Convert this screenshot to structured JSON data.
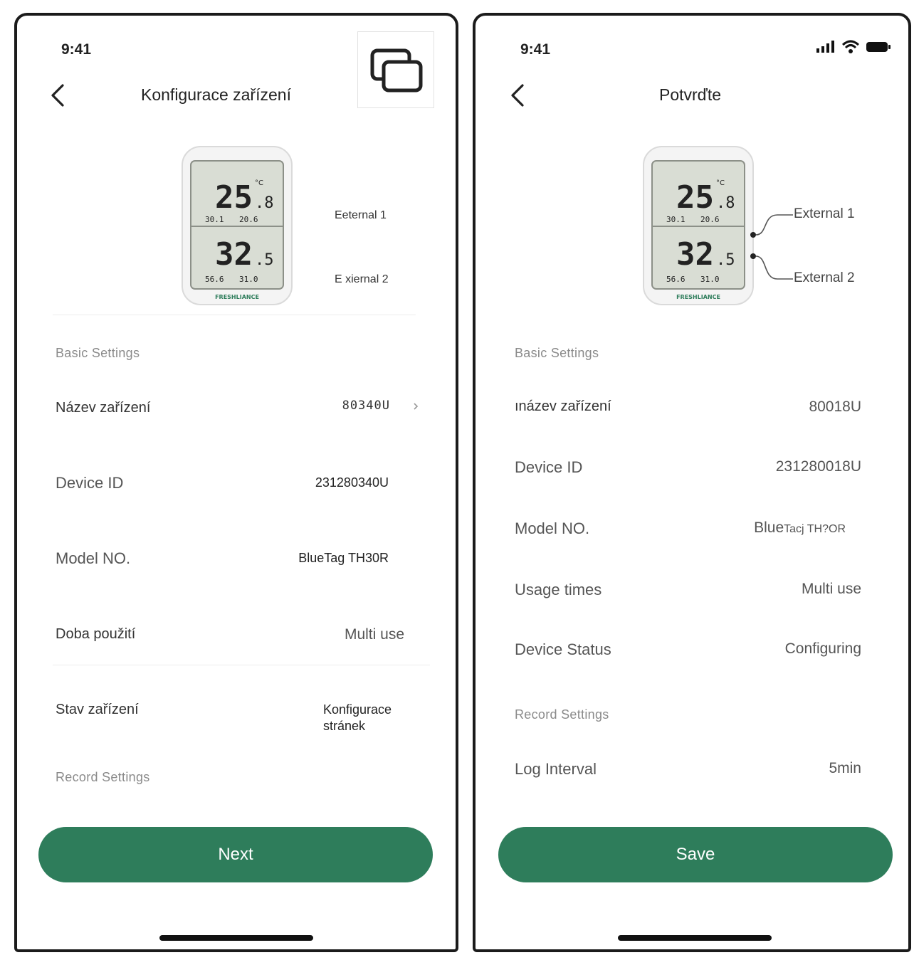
{
  "screen_left": {
    "time": "9:41",
    "title": "Konfigurace zařízení",
    "external_1": "Eeternal 1",
    "external_2": "E xiernal 2",
    "basic_settings": "Basic Settings",
    "rows": [
      {
        "label": "Název zařízení",
        "value": "80340U"
      },
      {
        "label": "Device ID",
        "value": "231280340U"
      },
      {
        "label": "Model NO.",
        "value": "BlueTag TH30R"
      },
      {
        "label": "Doba použití",
        "value": "Multi use"
      },
      {
        "label": "Stav zařízení",
        "value_line1": "Konfigurace",
        "value_line2": "stránek"
      }
    ],
    "record_settings": "Record Settings",
    "button": "Next"
  },
  "screen_right": {
    "time": "9:41",
    "title": "Potvrďte",
    "external_1": "External 1",
    "external_2": "External 2",
    "basic_settings": "Basic Settings",
    "rows": [
      {
        "label": "ınázev zařízení",
        "value": "80018U"
      },
      {
        "label": "Device ID",
        "value": "231280018U"
      },
      {
        "label": "Model NO.",
        "value_a": "Blue",
        "value_b": "Tacj TH?OR"
      },
      {
        "label": "Usage times",
        "value": "Multi use"
      },
      {
        "label": "Device Status",
        "value": "Configuring"
      }
    ],
    "record_settings": "Record Settings",
    "log_interval": {
      "label": "Log Interval",
      "value": "5min"
    },
    "button": "Save"
  },
  "device_display": {
    "brand": "FRESHLIANCE",
    "temp_main": "25",
    "temp_dec": ".8",
    "temp_unit": "°C",
    "hum_main": "32",
    "hum_dec": ".5",
    "small_1": "30.1",
    "small_2": "20.6",
    "small_3": "56.6",
    "small_4": "31.0"
  },
  "colors": {
    "accent": "#2e7d5b",
    "frame": "#1b1b1b",
    "section_text": "#8a8a8a"
  }
}
